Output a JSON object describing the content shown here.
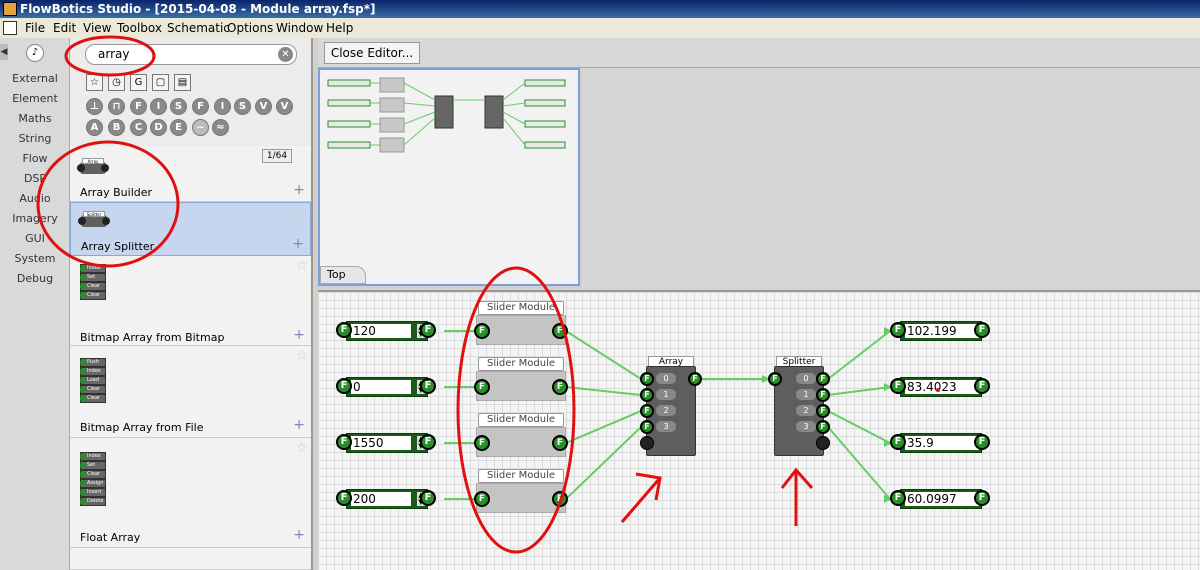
{
  "window": {
    "title": "FlowBotics Studio - [2015-04-08 - Module array.fsp*]"
  },
  "menu": [
    "File",
    "Edit",
    "View",
    "Toolbox",
    "Schematic",
    "Options",
    "Window",
    "Help"
  ],
  "categories": [
    "External",
    "Element",
    "Maths",
    "String",
    "Flow",
    "DSP",
    "Audio",
    "Imagery",
    "GUI",
    "System",
    "Debug"
  ],
  "search": {
    "value": "array"
  },
  "filters": {
    "row2": [
      "F",
      "I",
      "S",
      "F",
      "I",
      "S",
      "V",
      "V"
    ],
    "row3": [
      "A",
      "B",
      "C",
      "D",
      "E",
      "~",
      "≈"
    ]
  },
  "toolbox": {
    "count": "1/64",
    "items": [
      {
        "label": "Array Builder",
        "icon_title": "Array"
      },
      {
        "label": "Array Splitter",
        "icon_title": "Splitter"
      },
      {
        "label": "Bitmap Array from Bitmap",
        "icon_title": "Array",
        "rows": [
          "Index",
          "Set",
          "Clear",
          "Clear"
        ]
      },
      {
        "label": "Bitmap Array from File",
        "icon_title": "Array",
        "rows": [
          "Push",
          "Index",
          "Load",
          "Clear",
          "Clear"
        ]
      },
      {
        "label": "Float Array",
        "icon_title": "Array",
        "rows": [
          "Index",
          "Set",
          "Clear",
          "Assign",
          "Insert",
          "Delete"
        ]
      }
    ]
  },
  "editor": {
    "close_label": "Close Editor...",
    "nav_tab": "Top"
  },
  "inputs": [
    "120",
    "0",
    "1550",
    "200"
  ],
  "slider_title": "Slider Module",
  "array_module": {
    "title": "Array",
    "ports": [
      "0",
      "1",
      "2",
      "3"
    ]
  },
  "splitter_module": {
    "title": "Splitter",
    "ports": [
      "0",
      "1",
      "2",
      "3"
    ]
  },
  "outputs": [
    "102.199",
    "83.4023",
    "35.9",
    "60.0997"
  ],
  "annotation_color": "#e01010",
  "wire_color": "#66cc66"
}
